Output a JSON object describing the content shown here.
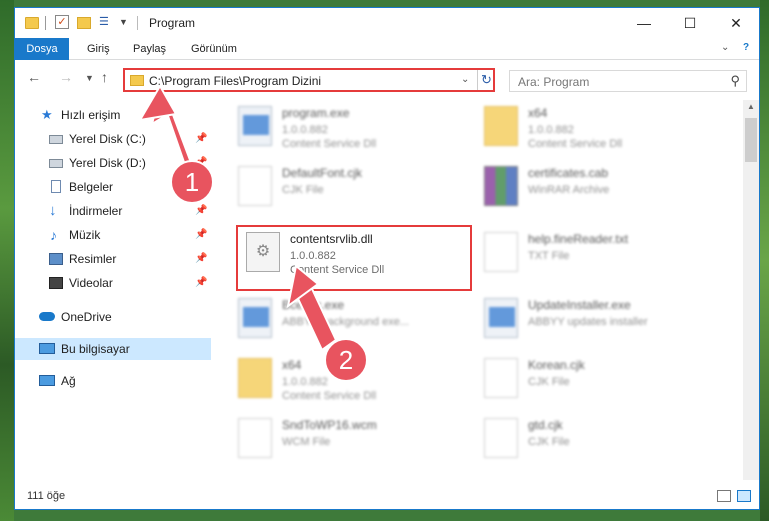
{
  "window": {
    "title": "Program",
    "controls": {
      "minimize": "—",
      "maximize": "☐",
      "close": "✕"
    }
  },
  "ribbon": {
    "tabs": [
      "Dosya",
      "Giriş",
      "Paylaş",
      "Görünüm"
    ],
    "active_tab": "Dosya",
    "accent": "#1979ca"
  },
  "address_bar": {
    "path": "C:\\Program Files\\Program Dizini",
    "highlight_color": "#e53b3b"
  },
  "search": {
    "placeholder": "Ara: Program"
  },
  "nav_pane": {
    "items": [
      {
        "label": "Hızlı erişim",
        "icon": "star-icon",
        "pinned": false
      },
      {
        "label": "Yerel Disk (C:)",
        "icon": "drive-icon",
        "pinned": true
      },
      {
        "label": "Yerel Disk (D:)",
        "icon": "drive-icon",
        "pinned": true
      },
      {
        "label": "Belgeler",
        "icon": "documents-icon",
        "pinned": true
      },
      {
        "label": "İndirmeler",
        "icon": "download-icon",
        "pinned": true
      },
      {
        "label": "Müzik",
        "icon": "music-icon",
        "pinned": true
      },
      {
        "label": "Resimler",
        "icon": "pictures-icon",
        "pinned": true
      },
      {
        "label": "Videolar",
        "icon": "videos-icon",
        "pinned": true
      },
      {
        "label": "OneDrive",
        "icon": "cloud-icon",
        "pinned": false
      },
      {
        "label": "Bu bilgisayar",
        "icon": "computer-icon",
        "pinned": false,
        "selected": true
      },
      {
        "label": "Ağ",
        "icon": "network-icon",
        "pinned": false
      }
    ]
  },
  "files": [
    {
      "name": "program.exe",
      "version": "1.0.0.882",
      "description": "Content Service Dll",
      "icon": "exe-icon",
      "blurred": true
    },
    {
      "name": "x64",
      "version": "1.0.0.882",
      "description": "Content Service Dll",
      "icon": "folder-icon",
      "blurred": true
    },
    {
      "name": "DefaultFont.cjk",
      "version": "",
      "description": "CJK File",
      "icon": "document-icon",
      "blurred": true
    },
    {
      "name": "certificates.cab",
      "version": "",
      "description": "WinRAR Archive",
      "icon": "archive-icon",
      "blurred": true
    },
    {
      "name": "contentsrvlib.dll",
      "version": "1.0.0.882",
      "description": "Content Service Dll",
      "icon": "dll-icon",
      "blurred": false
    },
    {
      "name": "help.fineReader.txt",
      "version": "",
      "description": "TXT File",
      "icon": "document-icon",
      "blurred": true
    },
    {
      "name": "Bcexec.exe",
      "version": "",
      "description": "ABBYY background exe...",
      "icon": "app-icon",
      "blurred": true
    },
    {
      "name": "UpdateInstaller.exe",
      "version": "",
      "description": "ABBYY updates installer",
      "icon": "app-icon",
      "blurred": true
    },
    {
      "name": "x64",
      "version": "1.0.0.882",
      "description": "Content Service Dll",
      "icon": "folder-icon",
      "blurred": true
    },
    {
      "name": "Korean.cjk",
      "version": "",
      "description": "CJK File",
      "icon": "document-icon",
      "blurred": true
    },
    {
      "name": "SndToWP16.wcm",
      "version": "",
      "description": "WCM File",
      "icon": "document-icon",
      "blurred": true
    },
    {
      "name": "gtd.cjk",
      "version": "",
      "description": "CJK File",
      "icon": "document-icon",
      "blurred": true
    }
  ],
  "annotations": {
    "step1": "1",
    "step2": "2",
    "color": "#e8545f"
  },
  "status_bar": {
    "item_count": "111 öğe"
  }
}
